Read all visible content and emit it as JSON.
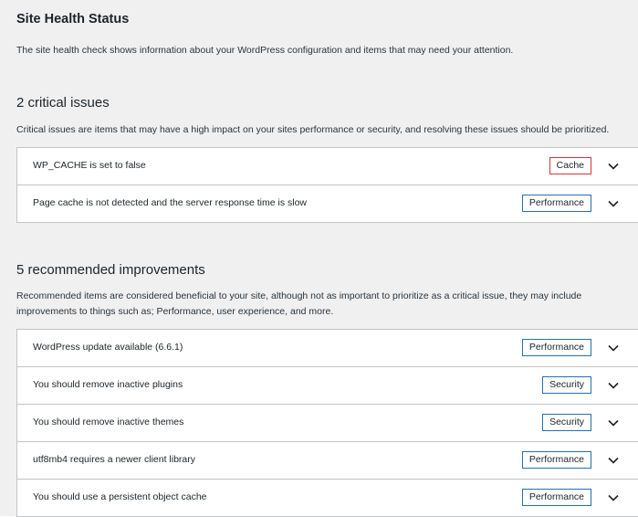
{
  "page": {
    "title": "Site Health Status",
    "description": "The site health check shows information about your WordPress configuration and items that may need your attention."
  },
  "critical": {
    "heading": "2 critical issues",
    "description": "Critical issues are items that may have a high impact on your sites performance or security, and resolving these issues should be prioritized.",
    "items": [
      {
        "title": "WP_CACHE is set to false",
        "badge": "Cache",
        "badge_color": "#d63638"
      },
      {
        "title": "Page cache is not detected and the server response time is slow",
        "badge": "Performance",
        "badge_color": "#2271b1"
      }
    ]
  },
  "recommended": {
    "heading": "5 recommended improvements",
    "description": "Recommended items are considered beneficial to your site, although not as important to prioritize as a critical issue, they may include improvements to things such as; Performance, user experience, and more.",
    "items": [
      {
        "title": "WordPress update available (6.6.1)",
        "badge": "Performance",
        "badge_color": "#2271b1"
      },
      {
        "title": "You should remove inactive plugins",
        "badge": "Security",
        "badge_color": "#2271b1"
      },
      {
        "title": "You should remove inactive themes",
        "badge": "Security",
        "badge_color": "#2271b1"
      },
      {
        "title": "utf8mb4 requires a newer client library",
        "badge": "Performance",
        "badge_color": "#2271b1"
      },
      {
        "title": "You should use a persistent object cache",
        "badge": "Performance",
        "badge_color": "#2271b1"
      }
    ]
  },
  "icons": {
    "expand": "chevron-down-icon"
  }
}
